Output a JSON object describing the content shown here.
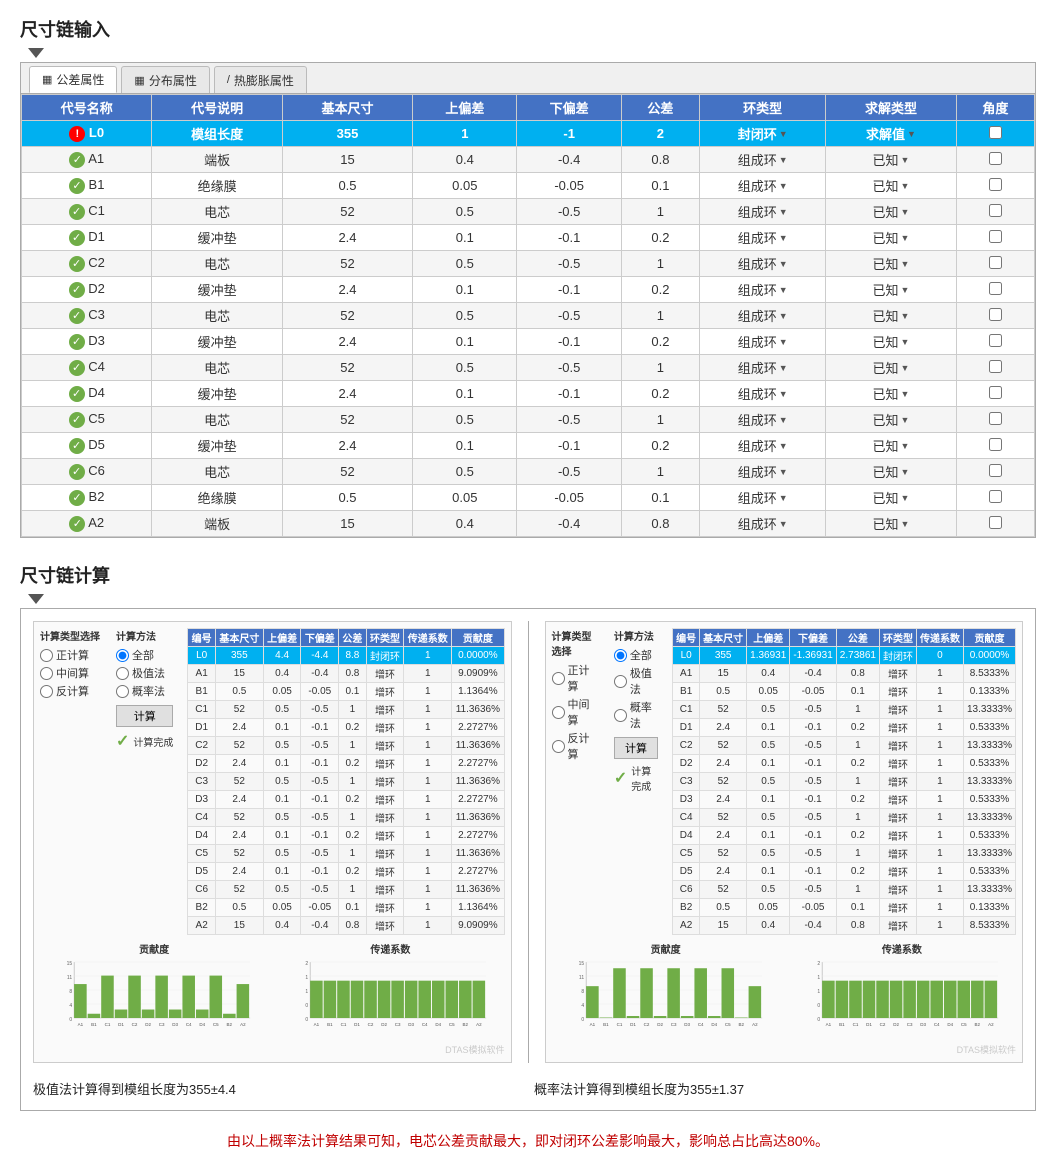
{
  "title1": "尺寸链输入",
  "title2": "尺寸链计算",
  "tabs": [
    {
      "label": "公差属性",
      "icon": "▦",
      "active": true
    },
    {
      "label": "分布属性",
      "icon": "▦"
    },
    {
      "label": "热膨胀属性",
      "icon": "/"
    }
  ],
  "table": {
    "headers": [
      "代号名称",
      "代号说明",
      "基本尺寸",
      "上偏差",
      "下偏差",
      "公差",
      "环类型",
      "求解类型",
      "角度"
    ],
    "rows": [
      {
        "status": "red",
        "code": "L0",
        "desc": "模组长度",
        "basic": "355",
        "upper": "1",
        "lower": "-1",
        "tol": "2",
        "ring_type": "封闭环",
        "solve_type": "求解值",
        "highlight": true
      },
      {
        "status": "green",
        "code": "A1",
        "desc": "端板",
        "basic": "15",
        "upper": "0.4",
        "lower": "-0.4",
        "tol": "0.8",
        "ring_type": "组成环",
        "solve_type": "已知"
      },
      {
        "status": "green",
        "code": "B1",
        "desc": "绝缘膜",
        "basic": "0.5",
        "upper": "0.05",
        "lower": "-0.05",
        "tol": "0.1",
        "ring_type": "组成环",
        "solve_type": "已知"
      },
      {
        "status": "green",
        "code": "C1",
        "desc": "电芯",
        "basic": "52",
        "upper": "0.5",
        "lower": "-0.5",
        "tol": "1",
        "ring_type": "组成环",
        "solve_type": "已知"
      },
      {
        "status": "green",
        "code": "D1",
        "desc": "缓冲垫",
        "basic": "2.4",
        "upper": "0.1",
        "lower": "-0.1",
        "tol": "0.2",
        "ring_type": "组成环",
        "solve_type": "已知"
      },
      {
        "status": "green",
        "code": "C2",
        "desc": "电芯",
        "basic": "52",
        "upper": "0.5",
        "lower": "-0.5",
        "tol": "1",
        "ring_type": "组成环",
        "solve_type": "已知"
      },
      {
        "status": "green",
        "code": "D2",
        "desc": "缓冲垫",
        "basic": "2.4",
        "upper": "0.1",
        "lower": "-0.1",
        "tol": "0.2",
        "ring_type": "组成环",
        "solve_type": "已知"
      },
      {
        "status": "green",
        "code": "C3",
        "desc": "电芯",
        "basic": "52",
        "upper": "0.5",
        "lower": "-0.5",
        "tol": "1",
        "ring_type": "组成环",
        "solve_type": "已知"
      },
      {
        "status": "green",
        "code": "D3",
        "desc": "缓冲垫",
        "basic": "2.4",
        "upper": "0.1",
        "lower": "-0.1",
        "tol": "0.2",
        "ring_type": "组成环",
        "solve_type": "已知"
      },
      {
        "status": "green",
        "code": "C4",
        "desc": "电芯",
        "basic": "52",
        "upper": "0.5",
        "lower": "-0.5",
        "tol": "1",
        "ring_type": "组成环",
        "solve_type": "已知"
      },
      {
        "status": "green",
        "code": "D4",
        "desc": "缓冲垫",
        "basic": "2.4",
        "upper": "0.1",
        "lower": "-0.1",
        "tol": "0.2",
        "ring_type": "组成环",
        "solve_type": "已知"
      },
      {
        "status": "green",
        "code": "C5",
        "desc": "电芯",
        "basic": "52",
        "upper": "0.5",
        "lower": "-0.5",
        "tol": "1",
        "ring_type": "组成环",
        "solve_type": "已知"
      },
      {
        "status": "green",
        "code": "D5",
        "desc": "缓冲垫",
        "basic": "2.4",
        "upper": "0.1",
        "lower": "-0.1",
        "tol": "0.2",
        "ring_type": "组成环",
        "solve_type": "已知"
      },
      {
        "status": "green",
        "code": "C6",
        "desc": "电芯",
        "basic": "52",
        "upper": "0.5",
        "lower": "-0.5",
        "tol": "1",
        "ring_type": "组成环",
        "solve_type": "已知"
      },
      {
        "status": "green",
        "code": "B2",
        "desc": "绝缘膜",
        "basic": "0.5",
        "upper": "0.05",
        "lower": "-0.05",
        "tol": "0.1",
        "ring_type": "组成环",
        "solve_type": "已知"
      },
      {
        "status": "green",
        "code": "A2",
        "desc": "端板",
        "basic": "15",
        "upper": "0.4",
        "lower": "-0.4",
        "tol": "0.8",
        "ring_type": "组成环",
        "solve_type": "已知"
      }
    ]
  },
  "calc": {
    "panel1": {
      "title": "极值法",
      "type_label": "计算类型选择",
      "types": [
        "正计算",
        "中间算",
        "反计算"
      ],
      "method_label": "计算方法",
      "methods": [
        "全部",
        "极值法",
        "概率法"
      ],
      "calc_btn": "计算",
      "done_text": "计算完成",
      "mini_table_headers": [
        "编号",
        "基本尺寸",
        "上偏差",
        "下偏差",
        "公差",
        "环类型",
        "传递系数",
        "贡献度"
      ],
      "mini_rows": [
        {
          "code": "L0",
          "basic": "355",
          "upper": "4.4",
          "lower": "-4.4",
          "tol": "8.8",
          "ring": "封闭环",
          "coeff": "1",
          "contrib": "0.0000%",
          "highlight": true
        },
        {
          "code": "A1",
          "basic": "15",
          "upper": "0.4",
          "lower": "-0.4",
          "tol": "0.8",
          "ring": "增环",
          "coeff": "1",
          "contrib": "9.0909%"
        },
        {
          "code": "B1",
          "basic": "0.5",
          "upper": "0.05",
          "lower": "-0.05",
          "tol": "0.1",
          "ring": "增环",
          "coeff": "1",
          "contrib": "1.1364%"
        },
        {
          "code": "C1",
          "basic": "52",
          "upper": "0.5",
          "lower": "-0.5",
          "tol": "1",
          "ring": "增环",
          "coeff": "1",
          "contrib": "11.3636%"
        },
        {
          "code": "D1",
          "basic": "2.4",
          "upper": "0.1",
          "lower": "-0.1",
          "tol": "0.2",
          "ring": "增环",
          "coeff": "1",
          "contrib": "2.2727%"
        },
        {
          "code": "C2",
          "basic": "52",
          "upper": "0.5",
          "lower": "-0.5",
          "tol": "1",
          "ring": "增环",
          "coeff": "1",
          "contrib": "11.3636%"
        },
        {
          "code": "D2",
          "basic": "2.4",
          "upper": "0.1",
          "lower": "-0.1",
          "tol": "0.2",
          "ring": "增环",
          "coeff": "1",
          "contrib": "2.2727%"
        },
        {
          "code": "C3",
          "basic": "52",
          "upper": "0.5",
          "lower": "-0.5",
          "tol": "1",
          "ring": "增环",
          "coeff": "1",
          "contrib": "11.3636%"
        },
        {
          "code": "D3",
          "basic": "2.4",
          "upper": "0.1",
          "lower": "-0.1",
          "tol": "0.2",
          "ring": "增环",
          "coeff": "1",
          "contrib": "2.2727%"
        },
        {
          "code": "C4",
          "basic": "52",
          "upper": "0.5",
          "lower": "-0.5",
          "tol": "1",
          "ring": "增环",
          "coeff": "1",
          "contrib": "11.3636%"
        },
        {
          "code": "D4",
          "basic": "2.4",
          "upper": "0.1",
          "lower": "-0.1",
          "tol": "0.2",
          "ring": "增环",
          "coeff": "1",
          "contrib": "2.2727%"
        },
        {
          "code": "C5",
          "basic": "52",
          "upper": "0.5",
          "lower": "-0.5",
          "tol": "1",
          "ring": "增环",
          "coeff": "1",
          "contrib": "11.3636%"
        },
        {
          "code": "D5",
          "basic": "2.4",
          "upper": "0.1",
          "lower": "-0.1",
          "tol": "0.2",
          "ring": "增环",
          "coeff": "1",
          "contrib": "2.2727%"
        },
        {
          "code": "C6",
          "basic": "52",
          "upper": "0.5",
          "lower": "-0.5",
          "tol": "1",
          "ring": "增环",
          "coeff": "1",
          "contrib": "11.3636%"
        },
        {
          "code": "B2",
          "basic": "0.5",
          "upper": "0.05",
          "lower": "-0.05",
          "tol": "0.1",
          "ring": "增环",
          "coeff": "1",
          "contrib": "1.1364%"
        },
        {
          "code": "A2",
          "basic": "15",
          "upper": "0.4",
          "lower": "-0.4",
          "tol": "0.8",
          "ring": "增环",
          "coeff": "1",
          "contrib": "9.0909%"
        }
      ],
      "contrib_title": "贡献度",
      "coeff_title": "传递系数",
      "contrib_bars": [
        9.09,
        1.14,
        11.36,
        2.27,
        11.36,
        2.27,
        11.36,
        2.27,
        11.36,
        2.27,
        11.36,
        1.14,
        9.09
      ],
      "contrib_labels": [
        "A1",
        "B1",
        "C1",
        "D1",
        "C2",
        "D2",
        "C3",
        "D3",
        "C4",
        "D4",
        "C5",
        "B2",
        "A2"
      ],
      "coeff_bars": [
        1,
        1,
        1,
        1,
        1,
        1,
        1,
        1,
        1,
        1,
        1,
        1,
        1
      ],
      "watermark": "DTAS模拟软件",
      "result": "极值法计算得到模组长度为355±4.4"
    },
    "panel2": {
      "title": "概率法",
      "type_label": "计算类型选择",
      "types": [
        "正计算",
        "中间算",
        "反计算"
      ],
      "method_label": "计算方法",
      "methods": [
        "全部",
        "极值法",
        "概率法"
      ],
      "calc_btn": "计算",
      "done_text": "计算完成",
      "mini_table_headers": [
        "编号",
        "基本尺寸",
        "上偏差",
        "下偏差",
        "公差",
        "环类型",
        "传递系数",
        "贡献度"
      ],
      "mini_rows": [
        {
          "code": "L0",
          "basic": "355",
          "upper": "1.36931",
          "lower": "-1.36931",
          "tol": "2.73861",
          "ring": "封闭环",
          "coeff": "0",
          "contrib": "0.0000%",
          "highlight": true
        },
        {
          "code": "A1",
          "basic": "15",
          "upper": "0.4",
          "lower": "-0.4",
          "tol": "0.8",
          "ring": "增环",
          "coeff": "1",
          "contrib": "8.5333%"
        },
        {
          "code": "B1",
          "basic": "0.5",
          "upper": "0.05",
          "lower": "-0.05",
          "tol": "0.1",
          "ring": "增环",
          "coeff": "1",
          "contrib": "0.1333%"
        },
        {
          "code": "C1",
          "basic": "52",
          "upper": "0.5",
          "lower": "-0.5",
          "tol": "1",
          "ring": "增环",
          "coeff": "1",
          "contrib": "13.3333%"
        },
        {
          "code": "D1",
          "basic": "2.4",
          "upper": "0.1",
          "lower": "-0.1",
          "tol": "0.2",
          "ring": "增环",
          "coeff": "1",
          "contrib": "0.5333%"
        },
        {
          "code": "C2",
          "basic": "52",
          "upper": "0.5",
          "lower": "-0.5",
          "tol": "1",
          "ring": "增环",
          "coeff": "1",
          "contrib": "13.3333%"
        },
        {
          "code": "D2",
          "basic": "2.4",
          "upper": "0.1",
          "lower": "-0.1",
          "tol": "0.2",
          "ring": "增环",
          "coeff": "1",
          "contrib": "0.5333%"
        },
        {
          "code": "C3",
          "basic": "52",
          "upper": "0.5",
          "lower": "-0.5",
          "tol": "1",
          "ring": "增环",
          "coeff": "1",
          "contrib": "13.3333%"
        },
        {
          "code": "D3",
          "basic": "2.4",
          "upper": "0.1",
          "lower": "-0.1",
          "tol": "0.2",
          "ring": "增环",
          "coeff": "1",
          "contrib": "0.5333%"
        },
        {
          "code": "C4",
          "basic": "52",
          "upper": "0.5",
          "lower": "-0.5",
          "tol": "1",
          "ring": "增环",
          "coeff": "1",
          "contrib": "13.3333%"
        },
        {
          "code": "D4",
          "basic": "2.4",
          "upper": "0.1",
          "lower": "-0.1",
          "tol": "0.2",
          "ring": "增环",
          "coeff": "1",
          "contrib": "0.5333%"
        },
        {
          "code": "C5",
          "basic": "52",
          "upper": "0.5",
          "lower": "-0.5",
          "tol": "1",
          "ring": "增环",
          "coeff": "1",
          "contrib": "13.3333%"
        },
        {
          "code": "D5",
          "basic": "2.4",
          "upper": "0.1",
          "lower": "-0.1",
          "tol": "0.2",
          "ring": "增环",
          "coeff": "1",
          "contrib": "0.5333%"
        },
        {
          "code": "C6",
          "basic": "52",
          "upper": "0.5",
          "lower": "-0.5",
          "tol": "1",
          "ring": "增环",
          "coeff": "1",
          "contrib": "13.3333%"
        },
        {
          "code": "B2",
          "basic": "0.5",
          "upper": "0.05",
          "lower": "-0.05",
          "tol": "0.1",
          "ring": "增环",
          "coeff": "1",
          "contrib": "0.1333%"
        },
        {
          "code": "A2",
          "basic": "15",
          "upper": "0.4",
          "lower": "-0.4",
          "tol": "0.8",
          "ring": "增环",
          "coeff": "1",
          "contrib": "8.5333%"
        }
      ],
      "contrib_title": "贡献度",
      "coeff_title": "传递系数",
      "contrib_bars": [
        8.53,
        0.13,
        13.33,
        0.53,
        13.33,
        0.53,
        13.33,
        0.53,
        13.33,
        0.53,
        13.33,
        0.13,
        8.53
      ],
      "contrib_labels": [
        "A1",
        "B1",
        "C1",
        "D1",
        "C2",
        "D2",
        "C3",
        "D3",
        "C4",
        "D4",
        "C5",
        "B2",
        "A2"
      ],
      "coeff_bars": [
        1,
        1,
        1,
        1,
        1,
        1,
        1,
        1,
        1,
        1,
        1,
        1,
        1
      ],
      "watermark": "DTAS模拟软件",
      "result": "概率法计算得到模组长度为355±1.37"
    },
    "conclusion": "由以上概率法计算结果可知，电芯公差贡献最大，即对闭环公差影响最大，影响总占比高达80%。"
  }
}
